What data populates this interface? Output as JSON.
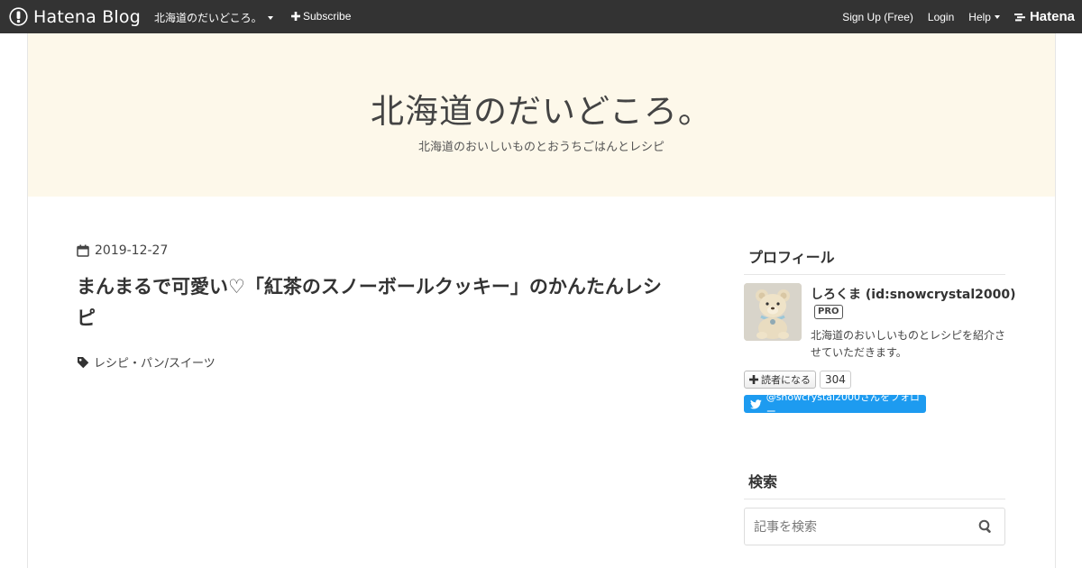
{
  "topbar": {
    "logo_text": "Hatena Blog",
    "blog_menu": "北海道のだいどころ。",
    "subscribe": "Subscribe",
    "signup": "Sign Up (Free)",
    "login": "Login",
    "help": "Help",
    "hatena": "Hatena"
  },
  "header": {
    "title": "北海道のだいどころ。",
    "description": "北海道のおいしいものとおうちごはんとレシピ"
  },
  "entry": {
    "date": "2019-12-27",
    "title": "まんまるで可愛い♡「紅茶のスノーボールクッキー」のかんたんレシピ",
    "category": "レシピ・パン/スイーツ"
  },
  "sidebar": {
    "profile_heading": "プロフィール",
    "profile_name": "しろくま (id:snowcrystal2000)",
    "pro_badge": "PRO",
    "profile_desc": "北海道のおいしいものとレシピを紹介させていただきます。",
    "reader_button": "読者になる",
    "reader_count": "304",
    "twitter_follow": "@snowcrystal2000さんをフォロー",
    "search_heading": "検索",
    "search_placeholder": "記事を検索"
  },
  "colors": {
    "topbar_bg": "#333333",
    "header_bg": "#fdf8ea",
    "twitter_blue": "#1d9bf0"
  },
  "icons": [
    "hatena-blog-logo-icon",
    "caret-down-icon",
    "plus-icon",
    "hatena-logo-icon",
    "calendar-icon",
    "tag-icon",
    "plus-icon",
    "twitter-icon",
    "search-icon"
  ]
}
